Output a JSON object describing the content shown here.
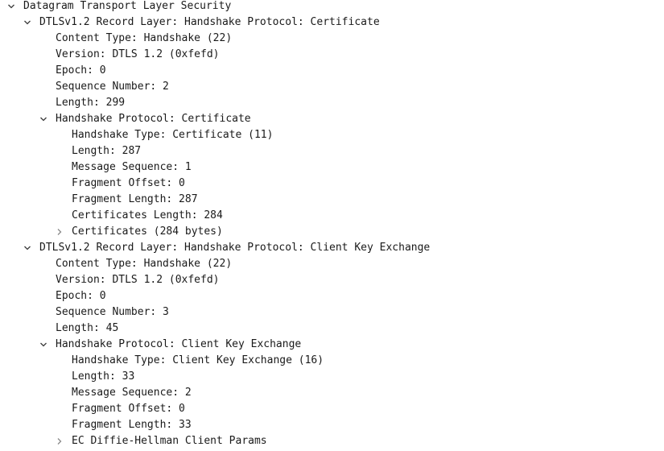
{
  "tree": {
    "rows": [
      {
        "label": "Datagram Transport Layer Security",
        "level": 0,
        "state": "expanded"
      },
      {
        "label": "DTLSv1.2 Record Layer: Handshake Protocol: Certificate",
        "level": 1,
        "state": "expanded"
      },
      {
        "label": "Content Type: Handshake (22)",
        "level": 2,
        "state": "leaf"
      },
      {
        "label": "Version: DTLS 1.2 (0xfefd)",
        "level": 2,
        "state": "leaf"
      },
      {
        "label": "Epoch: 0",
        "level": 2,
        "state": "leaf"
      },
      {
        "label": "Sequence Number: 2",
        "level": 2,
        "state": "leaf"
      },
      {
        "label": "Length: 299",
        "level": 2,
        "state": "leaf"
      },
      {
        "label": "Handshake Protocol: Certificate",
        "level": 2,
        "state": "expanded"
      },
      {
        "label": "Handshake Type: Certificate (11)",
        "level": 3,
        "state": "leaf"
      },
      {
        "label": "Length: 287",
        "level": 3,
        "state": "leaf"
      },
      {
        "label": "Message Sequence: 1",
        "level": 3,
        "state": "leaf"
      },
      {
        "label": "Fragment Offset: 0",
        "level": 3,
        "state": "leaf"
      },
      {
        "label": "Fragment Length: 287",
        "level": 3,
        "state": "leaf"
      },
      {
        "label": "Certificates Length: 284",
        "level": 3,
        "state": "leaf"
      },
      {
        "label": "Certificates (284 bytes)",
        "level": 3,
        "state": "collapsed"
      },
      {
        "label": "DTLSv1.2 Record Layer: Handshake Protocol: Client Key Exchange",
        "level": 1,
        "state": "expanded"
      },
      {
        "label": "Content Type: Handshake (22)",
        "level": 2,
        "state": "leaf"
      },
      {
        "label": "Version: DTLS 1.2 (0xfefd)",
        "level": 2,
        "state": "leaf"
      },
      {
        "label": "Epoch: 0",
        "level": 2,
        "state": "leaf"
      },
      {
        "label": "Sequence Number: 3",
        "level": 2,
        "state": "leaf"
      },
      {
        "label": "Length: 45",
        "level": 2,
        "state": "leaf"
      },
      {
        "label": "Handshake Protocol: Client Key Exchange",
        "level": 2,
        "state": "expanded"
      },
      {
        "label": "Handshake Type: Client Key Exchange (16)",
        "level": 3,
        "state": "leaf"
      },
      {
        "label": "Length: 33",
        "level": 3,
        "state": "leaf"
      },
      {
        "label": "Message Sequence: 2",
        "level": 3,
        "state": "leaf"
      },
      {
        "label": "Fragment Offset: 0",
        "level": 3,
        "state": "leaf"
      },
      {
        "label": "Fragment Length: 33",
        "level": 3,
        "state": "leaf"
      },
      {
        "label": "EC Diffie-Hellman Client Params",
        "level": 3,
        "state": "collapsed"
      }
    ]
  }
}
